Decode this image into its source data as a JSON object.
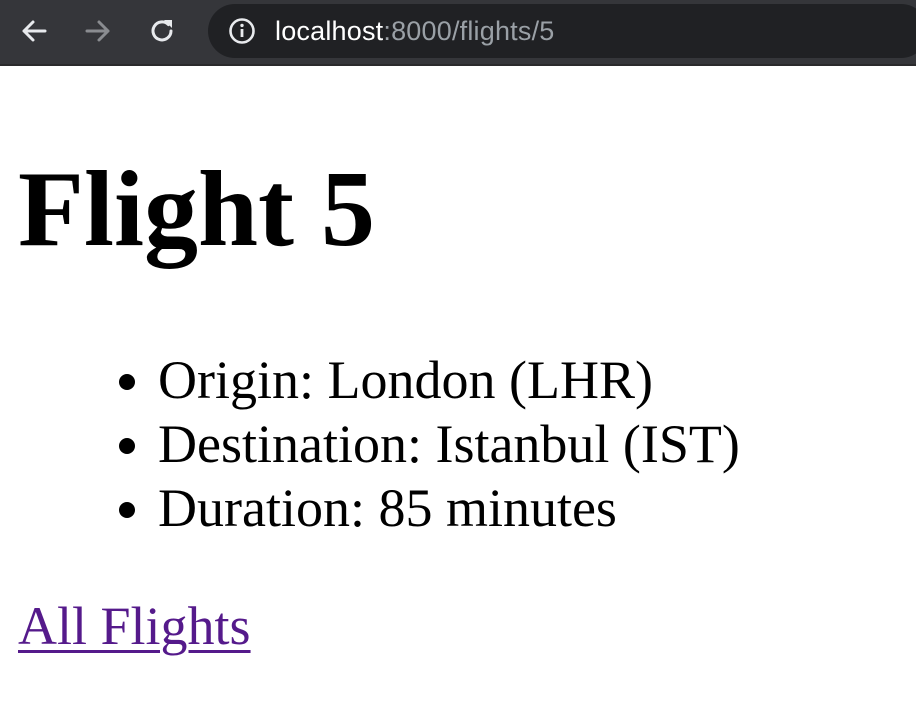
{
  "browser": {
    "url_host": "localhost",
    "url_path": ":8000/flights/5",
    "icons": {
      "back": "arrow-left-icon",
      "forward": "arrow-right-icon",
      "reload": "reload-icon",
      "info": "info-icon"
    },
    "colors": {
      "toolbar": "#35363a",
      "omnibox": "#202124",
      "host_text": "#ffffff",
      "path_text": "#9aa0a6"
    }
  },
  "page": {
    "title": "Flight 5",
    "details": [
      {
        "text": "Origin: London (LHR)"
      },
      {
        "text": "Destination: Istanbul (IST)"
      },
      {
        "text": "Duration: 85 minutes"
      }
    ],
    "link_label": "All Flights",
    "colors": {
      "link_visited": "#551a8b"
    }
  }
}
